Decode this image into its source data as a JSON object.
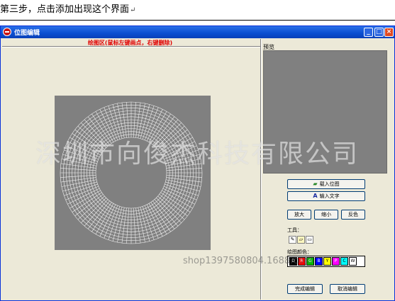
{
  "document": {
    "step_text": "第三步，点击添加出现这个界面",
    "paragraph_mark": "↵"
  },
  "window": {
    "title": "位图编辑",
    "controls": {
      "minimize": "_",
      "maximize": "□",
      "close": "×"
    }
  },
  "canvas": {
    "caption": "绘图区(鼠标左键画点，右键删除)",
    "background": "#808080",
    "grid_color": "#ffffff"
  },
  "preview": {
    "label": "预览"
  },
  "buttons": {
    "load_bitmap": "载入位图",
    "input_text": "输入文字",
    "zoom_in": "放大",
    "zoom_out": "缩小",
    "invert": "反色",
    "finish": "完成编辑",
    "cancel": "取消编辑"
  },
  "tools": {
    "label": "工具：",
    "items": [
      "pencil-icon",
      "eraser-icon",
      "rectangle-icon"
    ]
  },
  "colors": {
    "label": "绘图颜色：",
    "swatches": [
      {
        "code": "D",
        "hex": "#000000"
      },
      {
        "code": "R",
        "hex": "#ff0000"
      },
      {
        "code": "G",
        "hex": "#00c000"
      },
      {
        "code": "B",
        "hex": "#0000ff"
      },
      {
        "code": "Y",
        "hex": "#ffff00"
      },
      {
        "code": "P",
        "hex": "#ff00ff"
      },
      {
        "code": "C",
        "hex": "#00ffff"
      },
      {
        "code": "W",
        "hex": "#ffffff"
      }
    ]
  },
  "watermarks": {
    "company": "深圳市向俊杰科技有限公司",
    "shop": "shop1397580804.1688.com"
  }
}
